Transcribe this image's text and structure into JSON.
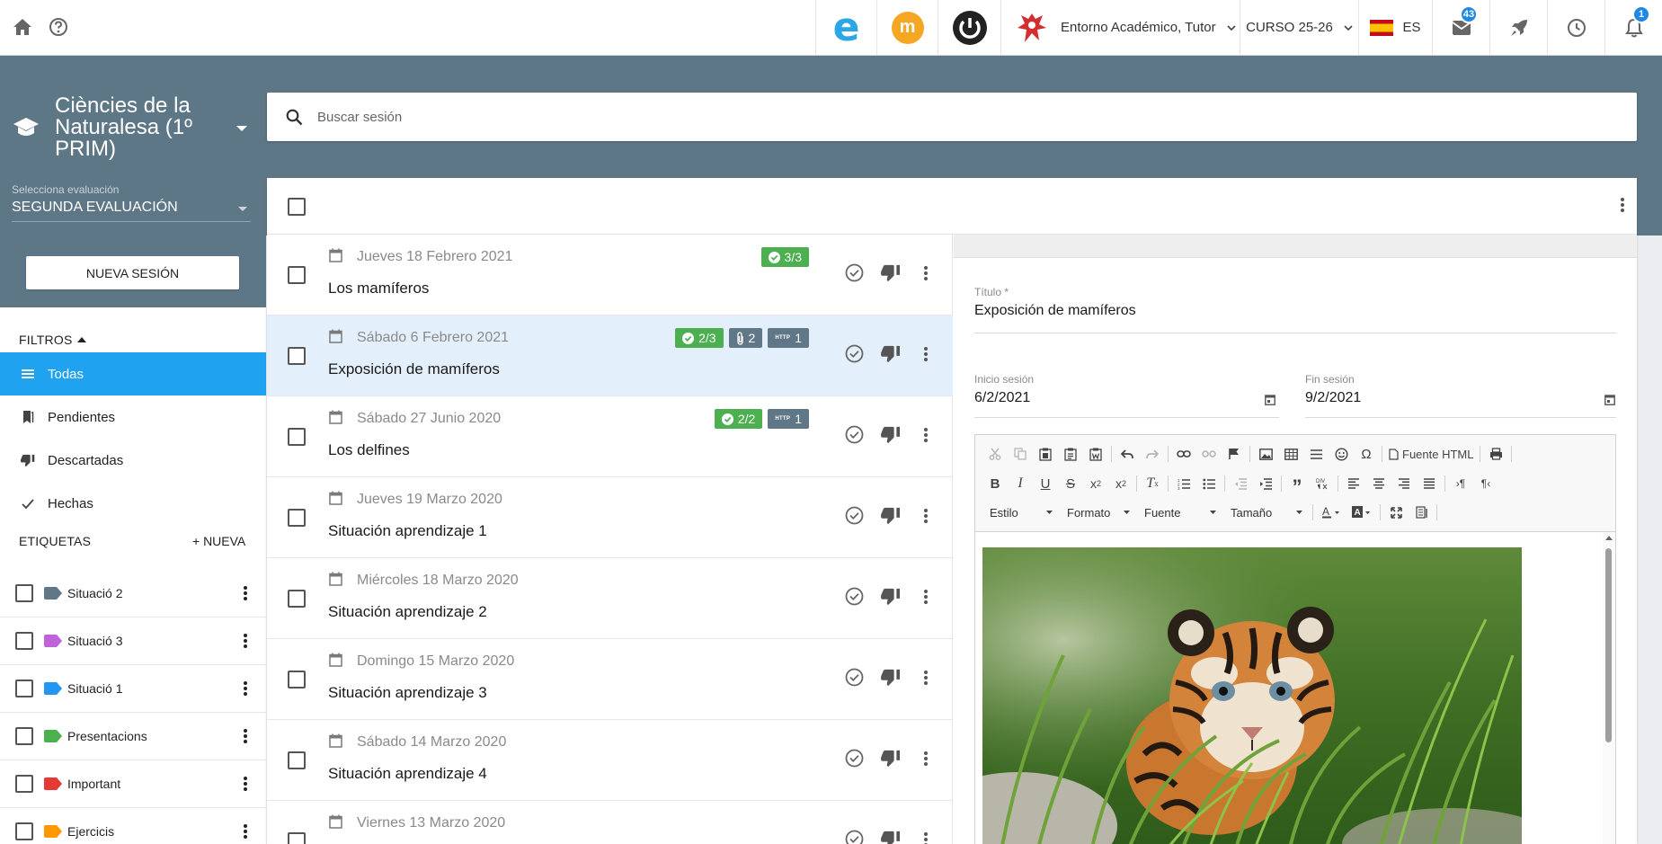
{
  "topbar": {
    "logo_e": "e",
    "logo_m": "m",
    "user_role": "Entorno Académico, Tutor",
    "course_year": "CURSO 25-26",
    "language": "ES",
    "mail_count": "43",
    "notification_count": "1"
  },
  "sidebar": {
    "course_title": "Ciències de la Naturalesa (1º PRIM)",
    "eval_label": "Selecciona evaluación",
    "eval_value": "SEGUNDA EVALUACIÓN",
    "new_session_label": "NUEVA SESIÓN",
    "filters_title": "FILTROS",
    "filters": [
      {
        "label": "Todas",
        "icon": "list-icon",
        "active": true
      },
      {
        "label": "Pendientes",
        "icon": "bookmark-icon",
        "active": false
      },
      {
        "label": "Descartadas",
        "icon": "thumb-down-icon",
        "active": false
      },
      {
        "label": "Hechas",
        "icon": "check-icon",
        "active": false
      }
    ],
    "tags_title": "ETIQUETAS",
    "new_tag_label": "+ NUEVA",
    "tags": [
      {
        "label": "Situació 2",
        "color": "#5f7786"
      },
      {
        "label": "Situació 3",
        "color": "#c062d9"
      },
      {
        "label": "Situació 1",
        "color": "#2196f3"
      },
      {
        "label": "Presentacions",
        "color": "#4caf50"
      },
      {
        "label": "Important",
        "color": "#e53935"
      },
      {
        "label": "Ejercicis",
        "color": "#ff9800"
      }
    ]
  },
  "search": {
    "placeholder": "Buscar sesión"
  },
  "sessions": [
    {
      "date": "Jueves 18 Febrero 2021",
      "title": "Los mamíferos",
      "done": "3/3",
      "attachments": "",
      "links": "",
      "selected": false
    },
    {
      "date": "Sábado 6 Febrero 2021",
      "title": "Exposición de mamíferos",
      "done": "2/3",
      "attachments": "2",
      "links": "1",
      "selected": true
    },
    {
      "date": "Sábado 27 Junio 2020",
      "title": "Los delfines",
      "done": "2/2",
      "attachments": "",
      "links": "1",
      "selected": false
    },
    {
      "date": "Jueves 19 Marzo 2020",
      "title": "Situación aprendizaje 1",
      "done": "",
      "attachments": "",
      "links": "",
      "selected": false
    },
    {
      "date": "Miércoles 18 Marzo 2020",
      "title": "Situación aprendizaje 2",
      "done": "",
      "attachments": "",
      "links": "",
      "selected": false
    },
    {
      "date": "Domingo 15 Marzo 2020",
      "title": "Situación aprendizaje 3",
      "done": "",
      "attachments": "",
      "links": "",
      "selected": false
    },
    {
      "date": "Sábado 14 Marzo 2020",
      "title": "Situación aprendizaje 4",
      "done": "",
      "attachments": "",
      "links": "",
      "selected": false
    },
    {
      "date": "Viernes 13 Marzo 2020",
      "title": "",
      "done": "",
      "attachments": "",
      "links": "",
      "selected": false
    }
  ],
  "link_chip_text": "HTTP",
  "detail": {
    "title_label": "Título *",
    "title_value": "Exposición de mamíferos",
    "start_label": "Inicio sesión",
    "start_value": "6/2/2021",
    "end_label": "Fin sesión",
    "end_value": "9/2/2021",
    "toolbar": {
      "source_label": "Fuente HTML",
      "style_label": "Estilo",
      "format_label": "Formato",
      "font_label": "Fuente",
      "size_label": "Tamaño"
    }
  }
}
